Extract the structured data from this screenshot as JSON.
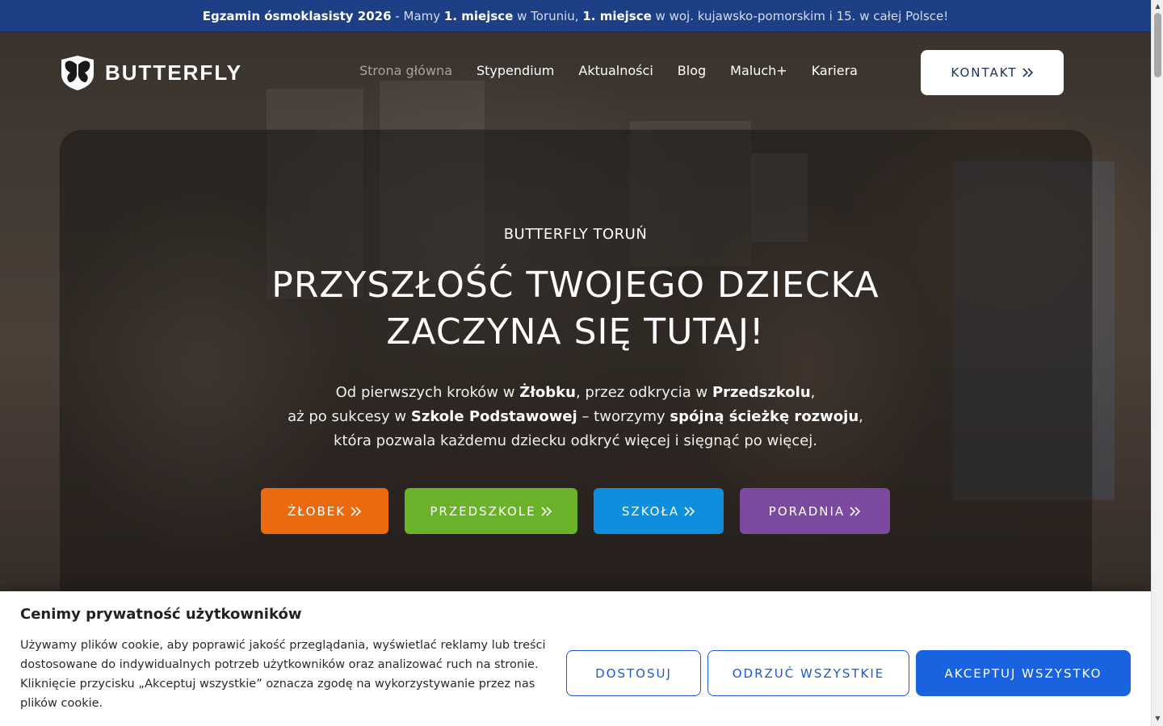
{
  "topbar": {
    "part1": "Egzamin ósmoklasisty 2026",
    "part2": " - Mamy ",
    "part3": "1. miejsce",
    "part4": " w Toruniu, ",
    "part5": "1. miejsce",
    "part6": " w woj. kujawsko-pomorskim i 15. w całej Polsce!"
  },
  "header": {
    "logo_text": "BUTTERFLY",
    "nav": [
      "Strona główna",
      "Stypendium",
      "Aktualności",
      "Blog",
      "Maluch+",
      "Kariera"
    ],
    "contact_label": "KONTAKT"
  },
  "hero": {
    "eyebrow": "BUTTERFLY TORUŃ",
    "headline_line1": "PRZYSZŁOŚĆ TWOJEGO DZIECKA",
    "headline_line2": "ZACZYNA SIĘ TUTAJ!",
    "lead": {
      "a1": "Od pierwszych kroków w ",
      "b1": "Żłobku",
      "a2": ", przez odkrycia w ",
      "b2": "Przedszkolu",
      "a3": ",",
      "a4": "aż po sukcesy w ",
      "b3": "Szkole Podstawowej",
      "a5": " – tworzymy ",
      "b4": "spójną ścieżkę rozwoju",
      "a6": ",",
      "a7": "która pozwala każdemu dziecku odkryć więcej i sięgnąć po więcej."
    },
    "buttons": [
      {
        "label": "ŻŁOBEK",
        "color": "#ec6a0e"
      },
      {
        "label": "PRZEDSZKOLE",
        "color": "#6ab22a"
      },
      {
        "label": "SZKOŁA",
        "color": "#0d8fde"
      },
      {
        "label": "PORADNIA",
        "color": "#7b4aa0"
      }
    ]
  },
  "cookie": {
    "title": "Cenimy prywatność użytkowników",
    "text": "Używamy plików cookie, aby poprawić jakość przeglądania, wyświetlać reklamy lub treści dostosowane do indywidualnych potrzeb użytkowników oraz analizować ruch na stronie. Kliknięcie przycisku „Akceptuj wszystkie” oznacza zgodę na wykorzystywanie przez nas plików cookie.",
    "customize_label": "DOSTOSUJ",
    "reject_label": "ODRZUĆ WSZYSTKIE",
    "accept_label": "AKCEPTUJ WSZYSTKO"
  },
  "icons": {
    "logo": "butterfly-logo-icon",
    "arrow": "double-chevron-right-icon"
  }
}
